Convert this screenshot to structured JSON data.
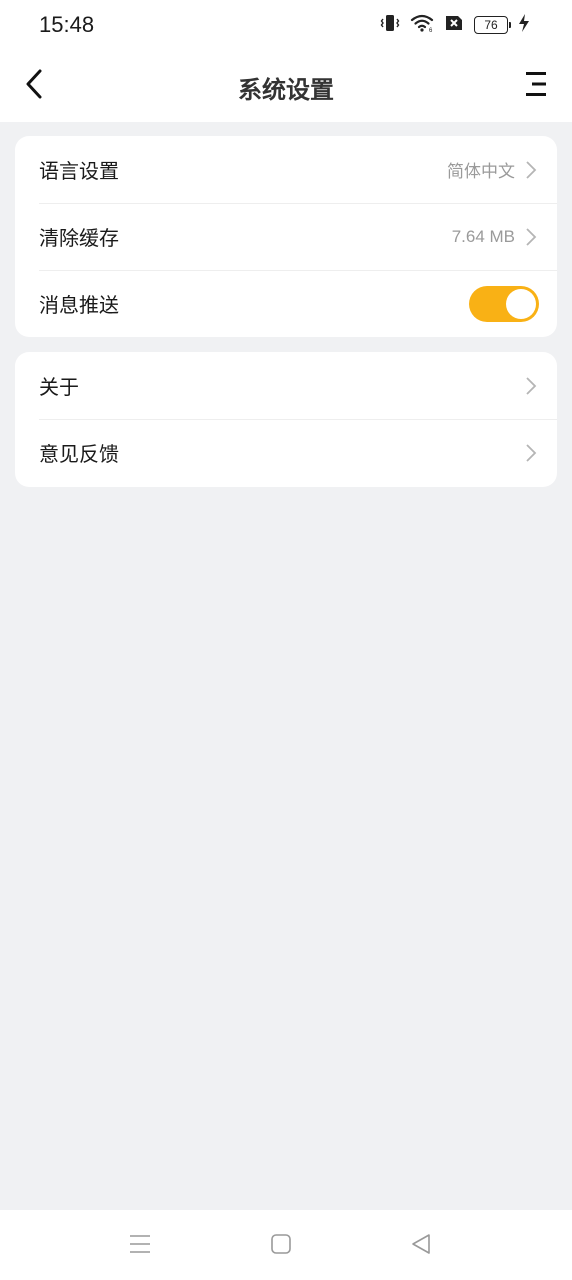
{
  "status_bar": {
    "time": "15:48",
    "battery_level": "76",
    "icons": [
      "vibrate-icon",
      "wifi-icon",
      "sim-blocked-icon",
      "battery-icon",
      "charging-icon"
    ]
  },
  "header": {
    "title": "系统设置",
    "back_icon": "chevron-left-icon",
    "menu_icon": "menu-icon"
  },
  "settings_group_1": {
    "items": [
      {
        "label": "语言设置",
        "value": "简体中文",
        "control": "chevron"
      },
      {
        "label": "清除缓存",
        "value": "7.64 MB",
        "control": "chevron"
      },
      {
        "label": "消息推送",
        "control": "toggle",
        "toggle_on": true
      }
    ]
  },
  "settings_group_2": {
    "items": [
      {
        "label": "关于",
        "control": "chevron"
      },
      {
        "label": "意见反馈",
        "control": "chevron"
      }
    ]
  },
  "nav_bar": {
    "icons": [
      "recent-apps-icon",
      "home-icon",
      "back-icon"
    ]
  },
  "colors": {
    "accent": "#f9b115",
    "background": "#f0f1f3",
    "card": "#ffffff",
    "secondary_text": "#9a9a9a"
  }
}
